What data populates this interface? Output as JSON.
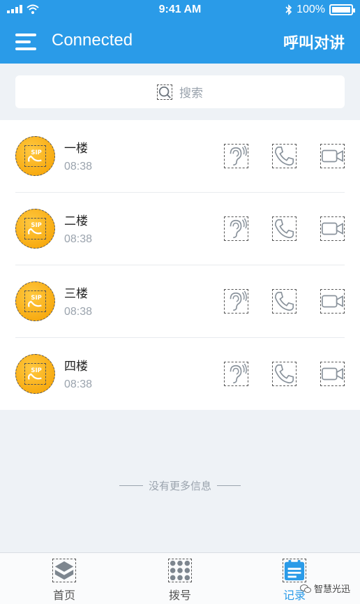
{
  "status_bar": {
    "time": "9:41 AM",
    "battery": "100%"
  },
  "nav": {
    "title": "Connected",
    "right_action": "呼叫对讲"
  },
  "search": {
    "placeholder": "搜索"
  },
  "records": [
    {
      "name": "一楼",
      "time": "08:38"
    },
    {
      "name": "二楼",
      "time": "08:38"
    },
    {
      "name": "三楼",
      "time": "08:38"
    },
    {
      "name": "四楼",
      "time": "08:38"
    }
  ],
  "list_footer": "没有更多信息",
  "tabs": [
    {
      "label": "首页",
      "icon": "layers-icon"
    },
    {
      "label": "拨号",
      "icon": "dialpad-icon"
    },
    {
      "label": "记录",
      "icon": "records-icon"
    }
  ],
  "watermark": "智慧光迅",
  "colors": {
    "primary": "#2a9be8",
    "avatar": "#f5a000",
    "icon_gray": "#8a939c"
  }
}
